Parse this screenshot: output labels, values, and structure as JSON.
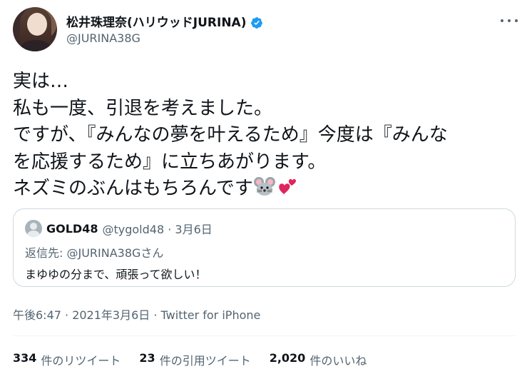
{
  "header": {
    "display_name": "松井珠理奈(ハリウッドJURINA)",
    "handle": "@JURINA38G",
    "verified_color": "#1d9bf0"
  },
  "tweet": {
    "text": "実は…\n私も一度、引退を考えました。\nですが、『みんなの夢を叶えるため』今度は『みんな\nを応援するため』に立ちあがります。\nネズミのぶんはもちろんです",
    "emojis": [
      "mouse-face",
      "two-hearts"
    ]
  },
  "quote": {
    "name": "GOLD48",
    "meta": "@tygold48 · 3月6日",
    "reply_prefix": "返信先: ",
    "reply_mention": "@JURINA38G",
    "reply_suffix": "さん",
    "body": "まゆゆの分まで、頑張って欲しい！"
  },
  "timestamp": {
    "time": "午後6:47 · 2021年3月6日",
    "separator": " · ",
    "source": "Twitter for iPhone"
  },
  "stats": [
    {
      "num": "334",
      "label": "件のリツイート"
    },
    {
      "num": "23",
      "label": "件の引用ツイート"
    },
    {
      "num": "2,020",
      "label": "件のいいね"
    }
  ]
}
